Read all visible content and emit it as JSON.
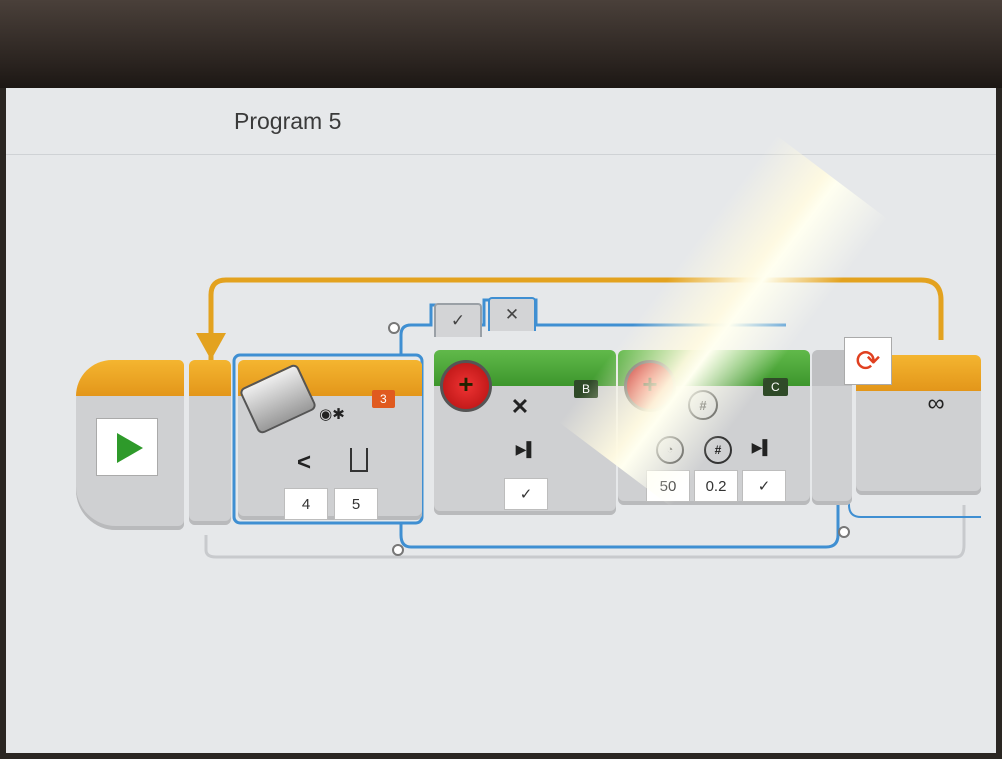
{
  "program": {
    "title": "Program 5"
  },
  "wait_block": {
    "port": "3",
    "compare_symbol": "<",
    "params": [
      "4",
      "5"
    ]
  },
  "motor_b": {
    "port": "B",
    "mode_symbol": "✕",
    "param": "✓"
  },
  "motor_c": {
    "port": "C",
    "params": [
      "50",
      "0.2",
      "✓"
    ]
  },
  "loop_block": {
    "count_symbol": "∞"
  },
  "switch_tabs": {
    "true_label": "✓",
    "false_label": "✕"
  },
  "colors": {
    "flow_orange": "#e3a21f",
    "motor_green": "#4aa635",
    "sensor_orange": "#e05a1f",
    "switch_blue": "#3f8fd2"
  }
}
